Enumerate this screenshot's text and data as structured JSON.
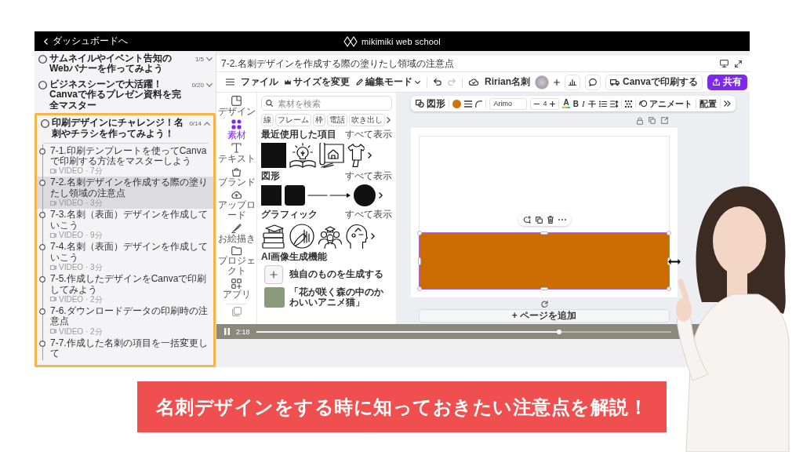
{
  "top_bar": {
    "back_label": "ダッシュボードへ",
    "logo_text": "mikimiki web school"
  },
  "sidebar": {
    "sections": [
      {
        "title": "サムネイルやイベント告知のWebバナーを作ってみよう",
        "progress": "1/5",
        "expanded": false,
        "highlighted": false
      },
      {
        "title": "ビジネスシーンで大活躍！Canvaで作るプレゼン資料を完全マスター",
        "progress": "0/20",
        "expanded": false,
        "highlighted": false
      },
      {
        "title": "印刷デザインにチャレンジ！名刺やチラシを作ってみよう！",
        "progress": "0/14",
        "expanded": true,
        "highlighted": true,
        "lessons": [
          {
            "title": "7-1.印刷テンプレートを使ってCanvaで印刷する方法をマスターしよう",
            "meta": "VIDEO · 7分",
            "selected": false
          },
          {
            "title": "7-2.名刺デザインを作成する際の塗りたし領域の注意点",
            "meta": "VIDEO · 3分",
            "selected": true
          },
          {
            "title": "7-3.名刺（表面）デザインを作成していこう",
            "meta": "VIDEO · 9分",
            "selected": false
          },
          {
            "title": "7-4.名刺（表面）デザインを作成していこう",
            "meta": "VIDEO · 3分",
            "selected": false
          },
          {
            "title": "7-5.作成したデザインをCanvaで印刷してみよう",
            "meta": "VIDEO · 2分",
            "selected": false
          },
          {
            "title": "7-6.ダウンロードデータの印刷時の注意点",
            "meta": "VIDEO · 2分",
            "selected": false
          },
          {
            "title": "7-7.作成した名刺の項目を一括変更して",
            "selected": false
          }
        ]
      }
    ]
  },
  "lesson": {
    "title": "7-2.名刺デザインを作成する際の塗りたし領域の注意点"
  },
  "editor": {
    "toolbar": {
      "file_menu": "ファイル",
      "resize": "サイズを変更",
      "edit_mode": "編集モード",
      "undo_disabled": false,
      "redo_disabled": true,
      "design_name": "Ririan名刺",
      "print_button": "Canvaで印刷する",
      "share_button": "共有"
    },
    "rail": [
      {
        "label": "デザイン",
        "selected": false
      },
      {
        "label": "素材",
        "selected": true
      },
      {
        "label": "テキスト",
        "selected": false
      },
      {
        "label": "ブランド",
        "selected": false
      },
      {
        "label": "アップロード",
        "selected": false
      },
      {
        "label": "お絵描き",
        "selected": false
      },
      {
        "label": "プロジェクト",
        "selected": false
      },
      {
        "label": "アプリ",
        "selected": false
      }
    ],
    "panel": {
      "search": {
        "placeholder": "素材を検索"
      },
      "chips": [
        "線",
        "フレーム",
        "枠",
        "電話",
        "吹き出し"
      ],
      "sections": [
        {
          "kind": "recent",
          "title": "最近使用した項目",
          "see_all": "すべて表示"
        },
        {
          "kind": "shapes",
          "title": "図形",
          "see_all": "すべて表示"
        },
        {
          "kind": "graphics",
          "title": "グラフィック",
          "see_all": "すべて表示"
        }
      ],
      "ai": {
        "title": "AI画像生成機能",
        "generate_label": "独自のものを生成する",
        "result_caption": "「花が咲く森の中のかわいいアニメ猫」"
      }
    },
    "shape_toolbar": {
      "shape_label": "図形",
      "font": "Arimo",
      "font_size": "4",
      "text_color": "A",
      "bold": "B",
      "italic": "I",
      "animate": "アニメート",
      "position": "配置"
    },
    "page": {
      "shape_selected": true,
      "add_page": "+ ページを追加"
    }
  },
  "video_controls": {
    "playing": true,
    "time": "2:18",
    "level": 0.73
  },
  "banner": {
    "text": "名刺デザインをする時に知っておきたい注意点を解説！"
  }
}
